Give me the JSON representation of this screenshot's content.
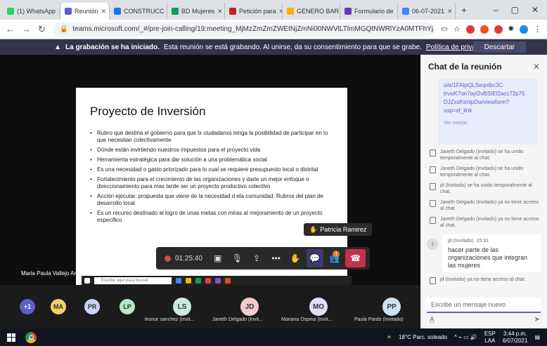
{
  "browser": {
    "tabs": [
      {
        "label": "(1) WhatsApp",
        "color": "#25d366"
      },
      {
        "label": "Reunión",
        "color": "#5b5fc7",
        "active": true
      },
      {
        "label": "CONSTRUCC",
        "color": "#1a73e8"
      },
      {
        "label": "BD Mujeres",
        "color": "#0f9d58"
      },
      {
        "label": "Petición para",
        "color": "#c5221f"
      },
      {
        "label": "GENERO BAR",
        "color": "#f4b400"
      },
      {
        "label": "Formulario de",
        "color": "#673ab7"
      },
      {
        "label": "06-07-2021",
        "color": "#4285f4"
      }
    ],
    "url": "teams.microsoft.com/_#/pre-join-calling/19:meeting_MjMzZmZmZWEtNjZmNi00NWVlLTlmMGQtNWRlYzA0MTFhYjA4@thread.v2"
  },
  "banner": {
    "bold": "La grabación se ha iniciado.",
    "text": "Esta reunión se está grabando. Al unirse, da su consentimiento para que se grabe.",
    "link": "Política de privacidad",
    "button": "Descartar"
  },
  "slide": {
    "title": "Proyecto de Inversión",
    "bullets": [
      "Rubro que destina el gobierno para que lx ciudadanxs tenga la posibilidad de participar en lo que necesitan colectivamente",
      "Dónde están invirtiendo nuestros impuestos para el proyecto vida",
      "Herramienta estratégica para dar solución a una problemática social",
      "Es una necesidad o gasto priorizado para lo cual se requiere presupuesto local o distrital",
      "Fortalecimiento para el crecimiento de las organizaciones y darle un mejor enfoque o direccionamiento para mas tarde ser un proyecto productivo colectivo",
      "Acción ejecutar, propuesta que viene de la necesidad d ela comunidad. Rubros del plan de desarrollo local",
      "Es un recurso destinado al logro de unas metas con miras al mejoramiento de un proyecto especifico"
    ]
  },
  "raised_hand_name": "Patricia Ramirez",
  "toolbar": {
    "timer": "01:25:40",
    "participants_badge": "1"
  },
  "self_name": "Maria Paula Vallejo Arteaga",
  "mini_taskbar": {
    "search": "Escribe aquí para buscar"
  },
  "participants": [
    {
      "initials": "+1",
      "color": "#5b5fc7",
      "fg": "#fff"
    },
    {
      "initials": "MA",
      "color": "#f2d06b",
      "fg": "#333"
    },
    {
      "initials": "PR",
      "color": "#c9d3f2",
      "fg": "#333"
    },
    {
      "initials": "LP",
      "color": "#b8e6c4",
      "fg": "#333"
    },
    {
      "initials": "LS",
      "color": "#cde8e2",
      "fg": "#333",
      "name": "leonor sanchez (Invit..."
    },
    {
      "initials": "JD",
      "color": "#f6c9d0",
      "fg": "#333",
      "name": "Janeth Delgado (Invit..."
    },
    {
      "initials": "MO",
      "color": "#e5ddf3",
      "fg": "#333",
      "name": "Mariana Ospina (Invit..."
    },
    {
      "initials": "PP",
      "color": "#cfe0f6",
      "fg": "#333",
      "name": "Paula Pardo (Invitado)"
    }
  ],
  "chat": {
    "title": "Chat de la reunión",
    "link_lines": [
      "u/e/1FAIpQLSeqnlbc3C-",
      "trvwK7on7ayl2vBSIEl2acc72p75",
      "DJZxsKtmlpDw/viewform?",
      "usp=sf_link"
    ],
    "see_less": "Ver menos",
    "system": [
      "Janeth Delgado (Invitado) se ha unido temporalmente al chat.",
      "Janeth Delgado (Invitado) se ha unido temporalmente al chat.",
      "jd (Invitado) se ha unido temporalmente al chat.",
      "Janeth Delgado (Invitado) ya no tiene acceso al chat.",
      "Janeth Delgado (Invitado) ya no tiene acceso al chat."
    ],
    "message": {
      "avatar": "J",
      "author": "jd (Invitado)",
      "time": "15:31",
      "text": "hacer parte de las organizaciones que integran las mujeres"
    },
    "last_system": "jd (Invitado) ya no tiene acceso al chat.",
    "placeholder": "Escribe un mensaje nuevo"
  },
  "taskbar": {
    "weather": "18°C Parc. soleado",
    "lang1": "ESP",
    "lang2": "LAA",
    "time": "3:44 p.m.",
    "date": "6/07/2021"
  }
}
